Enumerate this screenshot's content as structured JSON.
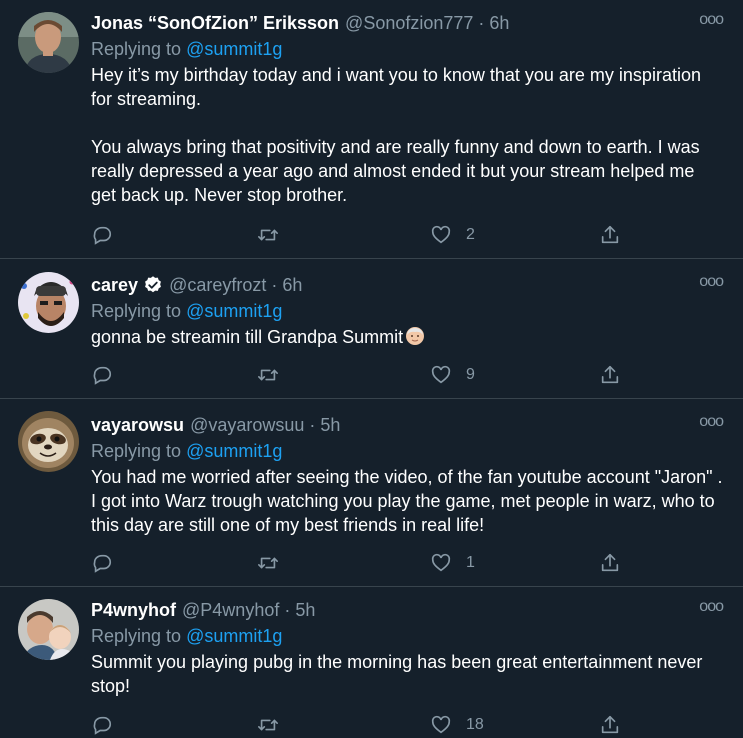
{
  "tweets": [
    {
      "name": "Jonas “SonOfZion” Eriksson",
      "handle": "@Sonofzion777",
      "dot": "·",
      "time": "6h",
      "more": "ooo",
      "replying_prefix": "Replying to ",
      "replying_to": "@summit1g",
      "text": "Hey it’s my birthday today and i want you to know that you are my inspiration for streaming.\n\nYou always bring that positivity and are really funny and down to earth. I was really depressed a year ago and almost ended it but your stream helped me get back up. Never stop brother.",
      "likes": "2",
      "verified": false,
      "avatar_icon": "person-avatar-icon"
    },
    {
      "name": "carey",
      "handle": "@careyfrozt",
      "dot": "·",
      "time": "6h",
      "more": "ooo",
      "replying_prefix": "Replying to ",
      "replying_to": "@summit1g",
      "text": "gonna be streamin till Grandpa Summit",
      "likes": "9",
      "verified": true,
      "avatar_icon": "person-avatar-icon"
    },
    {
      "name": "vayarowsu",
      "handle": "@vayarowsuu",
      "dot": "·",
      "time": "5h",
      "more": "ooo",
      "replying_prefix": "Replying to ",
      "replying_to": "@summit1g",
      "text": "You had me worried after seeing the video, of the fan youtube account \"Jaron\" . I got into Warz trough watching you play the game, met people in warz, who to this day are still one of my best friends in real life!",
      "likes": "1",
      "verified": false,
      "avatar_icon": "sloth-avatar-icon"
    },
    {
      "name": "P4wnyhof",
      "handle": "@P4wnyhof",
      "dot": "·",
      "time": "5h",
      "more": "ooo",
      "replying_prefix": "Replying to ",
      "replying_to": "@summit1g",
      "text": "Summit you playing pubg in the morning has been great entertainment never stop!",
      "likes": "18",
      "verified": false,
      "avatar_icon": "person-avatar-icon"
    }
  ],
  "icons": {
    "reply": "reply-icon",
    "retweet": "retweet-icon",
    "like": "heart-icon",
    "share": "share-icon",
    "emoji": "old-man-emoji-icon"
  },
  "colors": {
    "background": "#15202b",
    "border": "#38444d",
    "secondary_text": "#8899a6",
    "mention": "#1da1f2"
  }
}
